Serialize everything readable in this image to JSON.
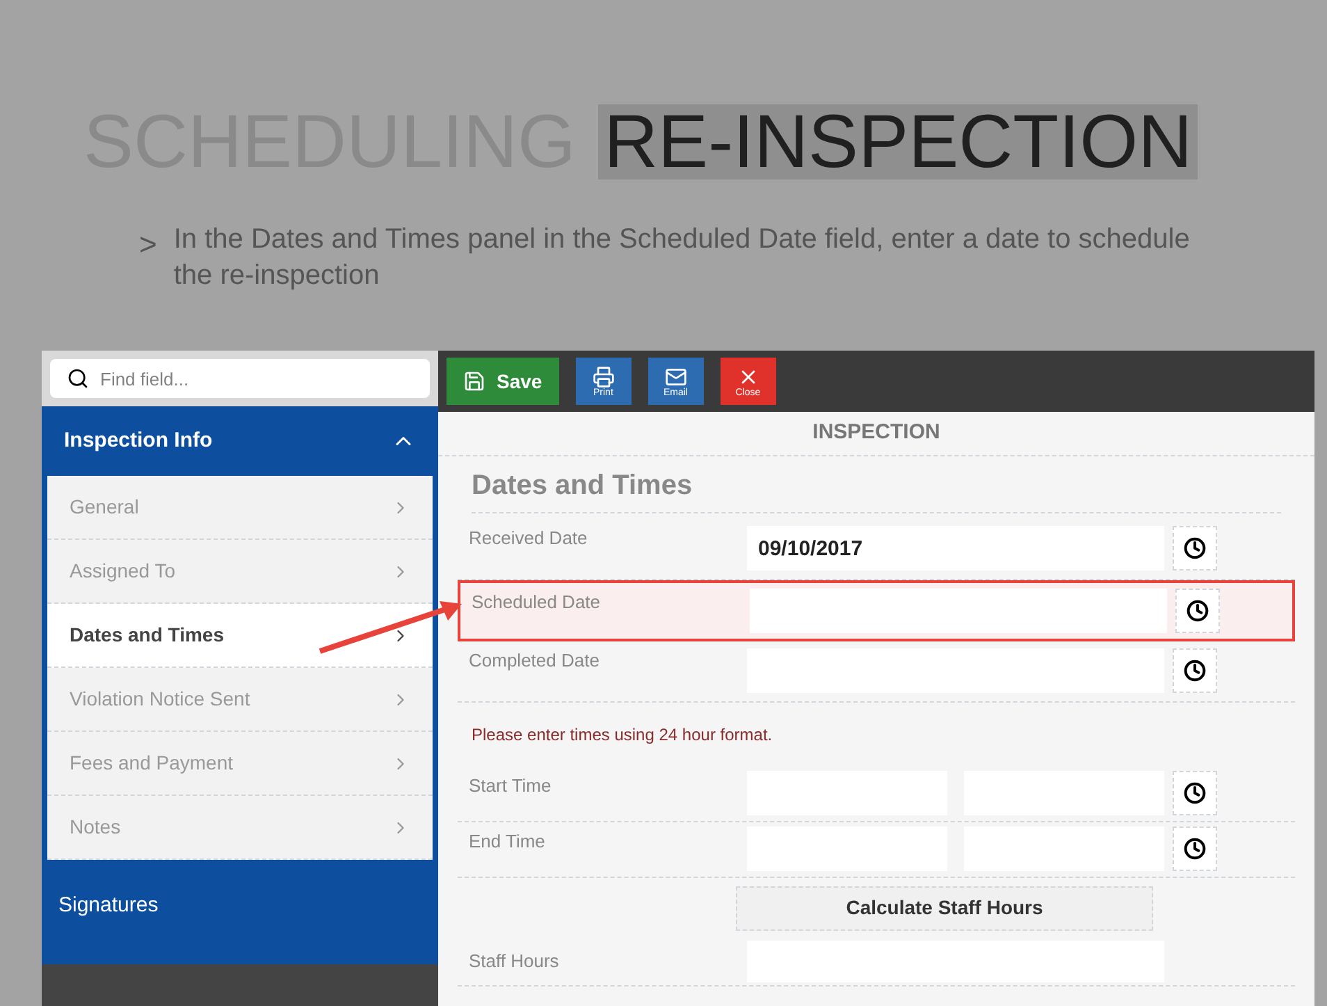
{
  "slide": {
    "title_parts": [
      {
        "text": "SCHEDULING",
        "highlighted": false
      },
      {
        "text": "RE-INSPECTION",
        "highlighted": true
      }
    ],
    "bullet_marker": ">",
    "bullet": "In the Dates and Times panel in the Scheduled Date field, enter a date to schedule the re-inspection"
  },
  "sidebar": {
    "search": {
      "placeholder": "Find field..."
    },
    "section": {
      "label": "Inspection Info",
      "expanded": true
    },
    "items": [
      {
        "label": "General",
        "selected": false
      },
      {
        "label": "Assigned To",
        "selected": false
      },
      {
        "label": "Dates and Times",
        "selected": true
      },
      {
        "label": "Violation Notice Sent",
        "selected": false
      },
      {
        "label": "Fees and Payment",
        "selected": false
      },
      {
        "label": "Notes",
        "selected": false
      }
    ],
    "footer_section": {
      "label": "Signatures"
    }
  },
  "toolbar": {
    "save": "Save",
    "buttons": [
      {
        "kind": "print",
        "label": "Print"
      },
      {
        "kind": "email",
        "label": "Email"
      },
      {
        "kind": "close",
        "label": "Close"
      }
    ]
  },
  "form": {
    "title": "INSPECTION",
    "heading": "Dates and Times",
    "rows": [
      {
        "kind": "date",
        "label": "Received Date",
        "value": "09/10/2017",
        "highlighted": false
      },
      {
        "kind": "date",
        "label": "Scheduled Date",
        "highlighted": true
      },
      {
        "kind": "date",
        "label": "Completed Date",
        "highlighted": false
      },
      {
        "kind": "note",
        "label": "Please enter times using 24 hour format."
      },
      {
        "kind": "time",
        "label": "Start Time",
        "highlighted": false
      },
      {
        "kind": "time",
        "label": "End Time",
        "highlighted": false
      },
      {
        "kind": "button",
        "label": "Calculate Staff Hours"
      },
      {
        "kind": "text",
        "label": "Staff Hours",
        "highlighted": false
      }
    ]
  }
}
